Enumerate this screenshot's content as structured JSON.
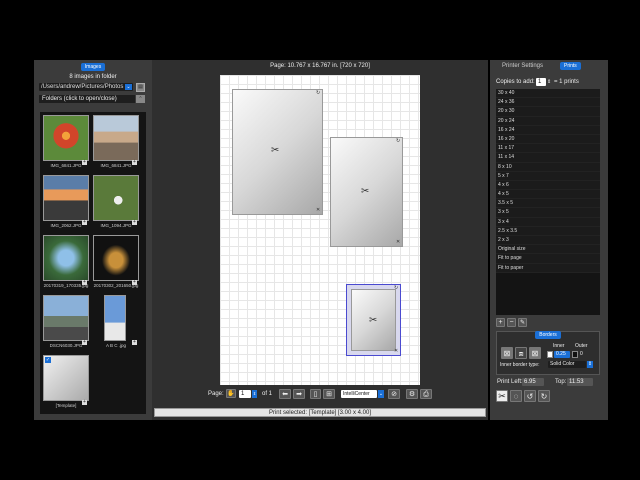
{
  "left": {
    "tab": "Images",
    "count_text": "8 images in folder",
    "path": "/Users/andrew/Pictures/Photos",
    "folders_label": "Folders (click to open/close)",
    "thumbnails": [
      {
        "caption": "IMG_6841.JPG"
      },
      {
        "caption": "IMG_6841.JPG"
      },
      {
        "caption": "IMG_2062.JPG"
      },
      {
        "caption": "IMG_1094.JPG"
      },
      {
        "caption": "20170319_170335.jpg"
      },
      {
        "caption": "20170302_201650.jpg"
      },
      {
        "caption": "DSCN6030.JPG"
      },
      {
        "caption": "A B C .jpg"
      },
      {
        "caption": "[Template]"
      }
    ]
  },
  "center": {
    "page_info": "Page: 10.767 x 16.767 in. [720 x 720]",
    "page_label": "Page:",
    "page_value": "1",
    "page_of": "of 1",
    "layout_mode": "IntelliCenter",
    "status": "Print selected: [Template] [3.00 x 4.00]"
  },
  "right": {
    "tab_settings": "Printer Settings",
    "tab_prints": "Prints",
    "copies_label": "Copies to add:",
    "copies_value": "1",
    "copies_suffix": "= 1 prints",
    "sizes": [
      "30 x 40",
      "24 x 36",
      "20 x 30",
      "20 x 24",
      "16 x 24",
      "16 x 20",
      "11 x 17",
      "11 x 14",
      "8 x 10",
      "5 x 7",
      "4 x 6",
      "4 x 5",
      "3.5 x 5",
      "3 x 5",
      "3 x 4",
      "2.5 x 3.5",
      "2 x 3",
      "Original size",
      "Fit to page",
      "Fit to paper"
    ],
    "borders_tab": "Borders",
    "inner_label": "Inner",
    "outer_label": "Outer",
    "inner_value": "0.25",
    "outer_value": "0",
    "inner_type_label": "Inner border type:",
    "inner_type_value": "Solid Color",
    "print_left_label": "Print Left:",
    "print_left_value": "6.95",
    "top_label": "Top:",
    "top_value": "11.53"
  },
  "colors": {
    "accent": "#1a6fd6",
    "selection": "#4a4ad0"
  }
}
